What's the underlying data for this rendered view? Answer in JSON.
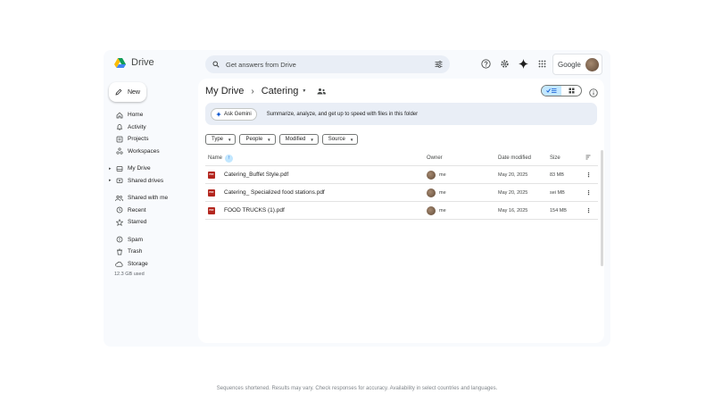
{
  "app": {
    "name": "Drive",
    "account_label": "Google"
  },
  "search": {
    "placeholder": "Get answers from Drive"
  },
  "new_button": {
    "label": "New"
  },
  "sidebar": {
    "items": [
      {
        "label": "Home",
        "icon": "home-icon"
      },
      {
        "label": "Activity",
        "icon": "bell-icon"
      },
      {
        "label": "Projects",
        "icon": "projects-icon"
      },
      {
        "label": "Workspaces",
        "icon": "workspaces-icon"
      },
      {
        "label": "My Drive",
        "icon": "drive-icon"
      },
      {
        "label": "Shared drives",
        "icon": "shared-drives-icon"
      },
      {
        "label": "Shared with me",
        "icon": "people-icon"
      },
      {
        "label": "Recent",
        "icon": "clock-icon"
      },
      {
        "label": "Starred",
        "icon": "star-icon"
      },
      {
        "label": "Spam",
        "icon": "spam-icon"
      },
      {
        "label": "Trash",
        "icon": "trash-icon"
      },
      {
        "label": "Storage",
        "icon": "cloud-icon"
      }
    ],
    "storage_text": "12.3 GB used"
  },
  "breadcrumb": {
    "root": "My Drive",
    "current": "Catering"
  },
  "gemini": {
    "button_label": "Ask Gemini",
    "prompt": "Summarize, analyze, and get up to speed with files in this folder"
  },
  "filters": [
    "Type",
    "People",
    "Modified",
    "Source"
  ],
  "table": {
    "columns": {
      "name": "Name",
      "owner": "Owner",
      "date": "Date modified",
      "size": "Size"
    },
    "rows": [
      {
        "name": "Catering_Buffet Style.pdf",
        "owner": "me",
        "date": "May 20, 2025",
        "size": "83 MB"
      },
      {
        "name": "Catering_ Specialized food stations.pdf",
        "owner": "me",
        "date": "May 20, 2025",
        "size": "sei MB"
      },
      {
        "name": "FOOD TRUCKS (1).pdf",
        "owner": "me",
        "date": "May 16, 2025",
        "size": "154 MB"
      }
    ]
  },
  "footer": {
    "disclaimer": "Sequences shortened. Results may vary. Check responses for accuracy. Availability in select countries and languages."
  },
  "colors": {
    "accent": "#0b57d0",
    "accent_light": "#c2e7ff",
    "pdf_red": "#b3261e",
    "surface": "#f8fafd"
  }
}
